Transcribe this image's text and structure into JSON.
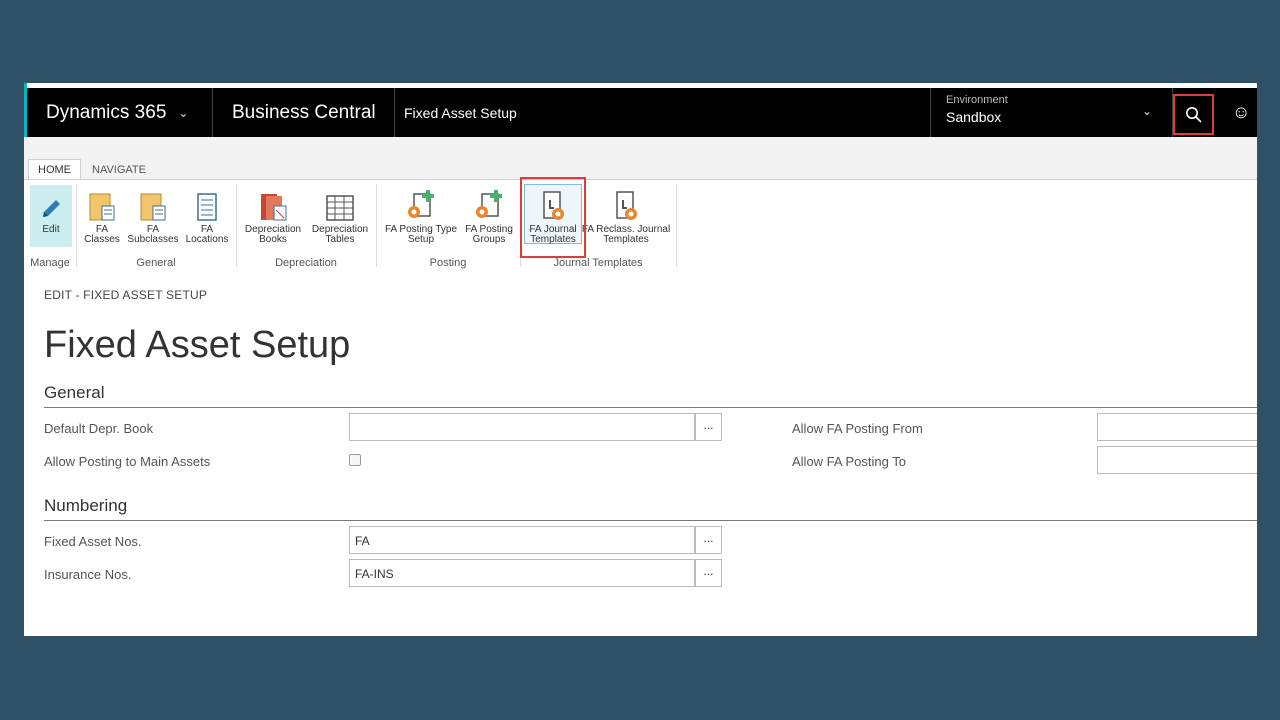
{
  "topbar": {
    "brand": "Dynamics 365",
    "app": "Business Central",
    "page": "Fixed Asset Setup",
    "environment_label": "Environment",
    "environment_value": "Sandbox"
  },
  "ribbon": {
    "tabs": [
      "HOME",
      "NAVIGATE"
    ],
    "groups": {
      "manage": "Manage",
      "general": "General",
      "depreciation": "Depreciation",
      "posting": "Posting",
      "journal": "Journal Templates"
    },
    "buttons": {
      "edit": "Edit",
      "fa_classes": [
        "FA",
        "Classes"
      ],
      "fa_subclasses": [
        "FA",
        "Subclasses"
      ],
      "fa_locations": [
        "FA",
        "Locations"
      ],
      "dep_books": [
        "Depreciation",
        "Books"
      ],
      "dep_tables": [
        "Depreciation",
        "Tables"
      ],
      "fa_posting_type": [
        "FA Posting Type",
        "Setup"
      ],
      "fa_posting_groups": [
        "FA Posting",
        "Groups"
      ],
      "fa_journal": [
        "FA Journal",
        "Templates"
      ],
      "fa_reclass": [
        "FA Reclass. Journal",
        "Templates"
      ]
    }
  },
  "page": {
    "breadcrumb": "EDIT - FIXED ASSET SETUP",
    "title": "Fixed Asset Setup",
    "general": {
      "heading": "General",
      "default_depr_book_label": "Default Depr. Book",
      "default_depr_book_value": "",
      "allow_posting_main_label": "Allow Posting to Main Assets",
      "allow_posting_main_checked": false,
      "allow_from_label": "Allow FA Posting From",
      "allow_from_value": "",
      "allow_to_label": "Allow FA Posting To",
      "allow_to_value": ""
    },
    "numbering": {
      "heading": "Numbering",
      "fixed_asset_nos_label": "Fixed Asset Nos.",
      "fixed_asset_nos_value": "FA",
      "insurance_nos_label": "Insurance Nos.",
      "insurance_nos_value": "FA-INS"
    },
    "lookup_label": "..."
  },
  "colors": {
    "background": "#2f5166",
    "highlight": "#e03b3b",
    "accent": "#00b7c3"
  }
}
